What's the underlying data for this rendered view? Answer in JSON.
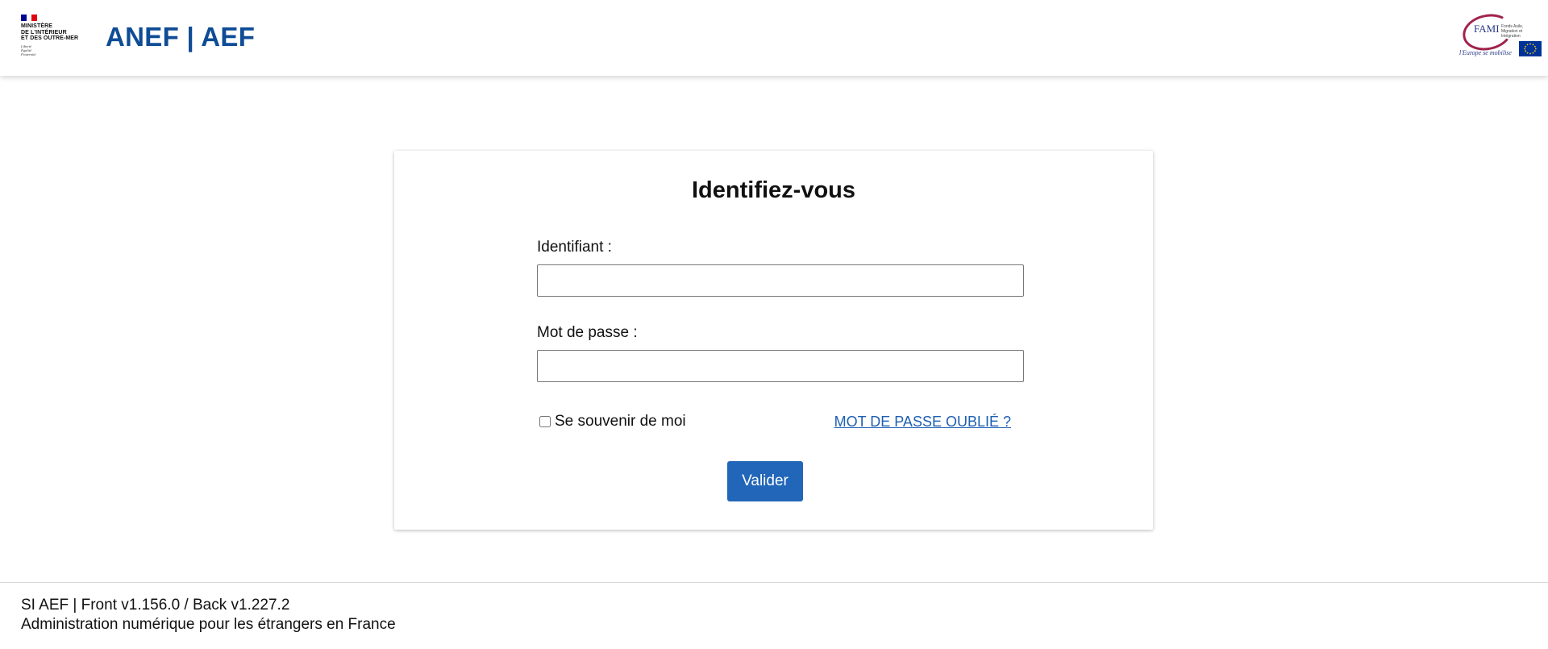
{
  "header": {
    "ministry_name": "MINISTÈRE\nDE L'INTÉRIEUR\nET DES OUTRE-MER",
    "motto": "Liberté\nÉgalité\nFraternité",
    "app_title": "ANEF | AEF",
    "partner_logo": {
      "name": "FAMI",
      "subtitle": "Fonds Asile, Migration et Intégration",
      "tagline": "l'Europe se mobilise"
    },
    "flag_colors": [
      "#000091",
      "#ffffff",
      "#e1000f"
    ]
  },
  "login": {
    "title": "Identifiez-vous",
    "identifier_label": "Identifiant :",
    "identifier_value": "",
    "password_label": "Mot de passe :",
    "password_value": "",
    "remember_label": "Se souvenir de moi",
    "remember_checked": false,
    "forgot_label": "MOT DE PASSE OUBLIÉ ?",
    "submit_label": "Valider"
  },
  "footer": {
    "version_line": "SI AEF | Front v1.156.0 / Back v1.227.2",
    "description_line": "Administration numérique pour les étrangers en France"
  },
  "colors": {
    "brand_blue": "#0f4c95",
    "button_blue": "#2166b8",
    "link_blue": "#1d5fb3"
  }
}
